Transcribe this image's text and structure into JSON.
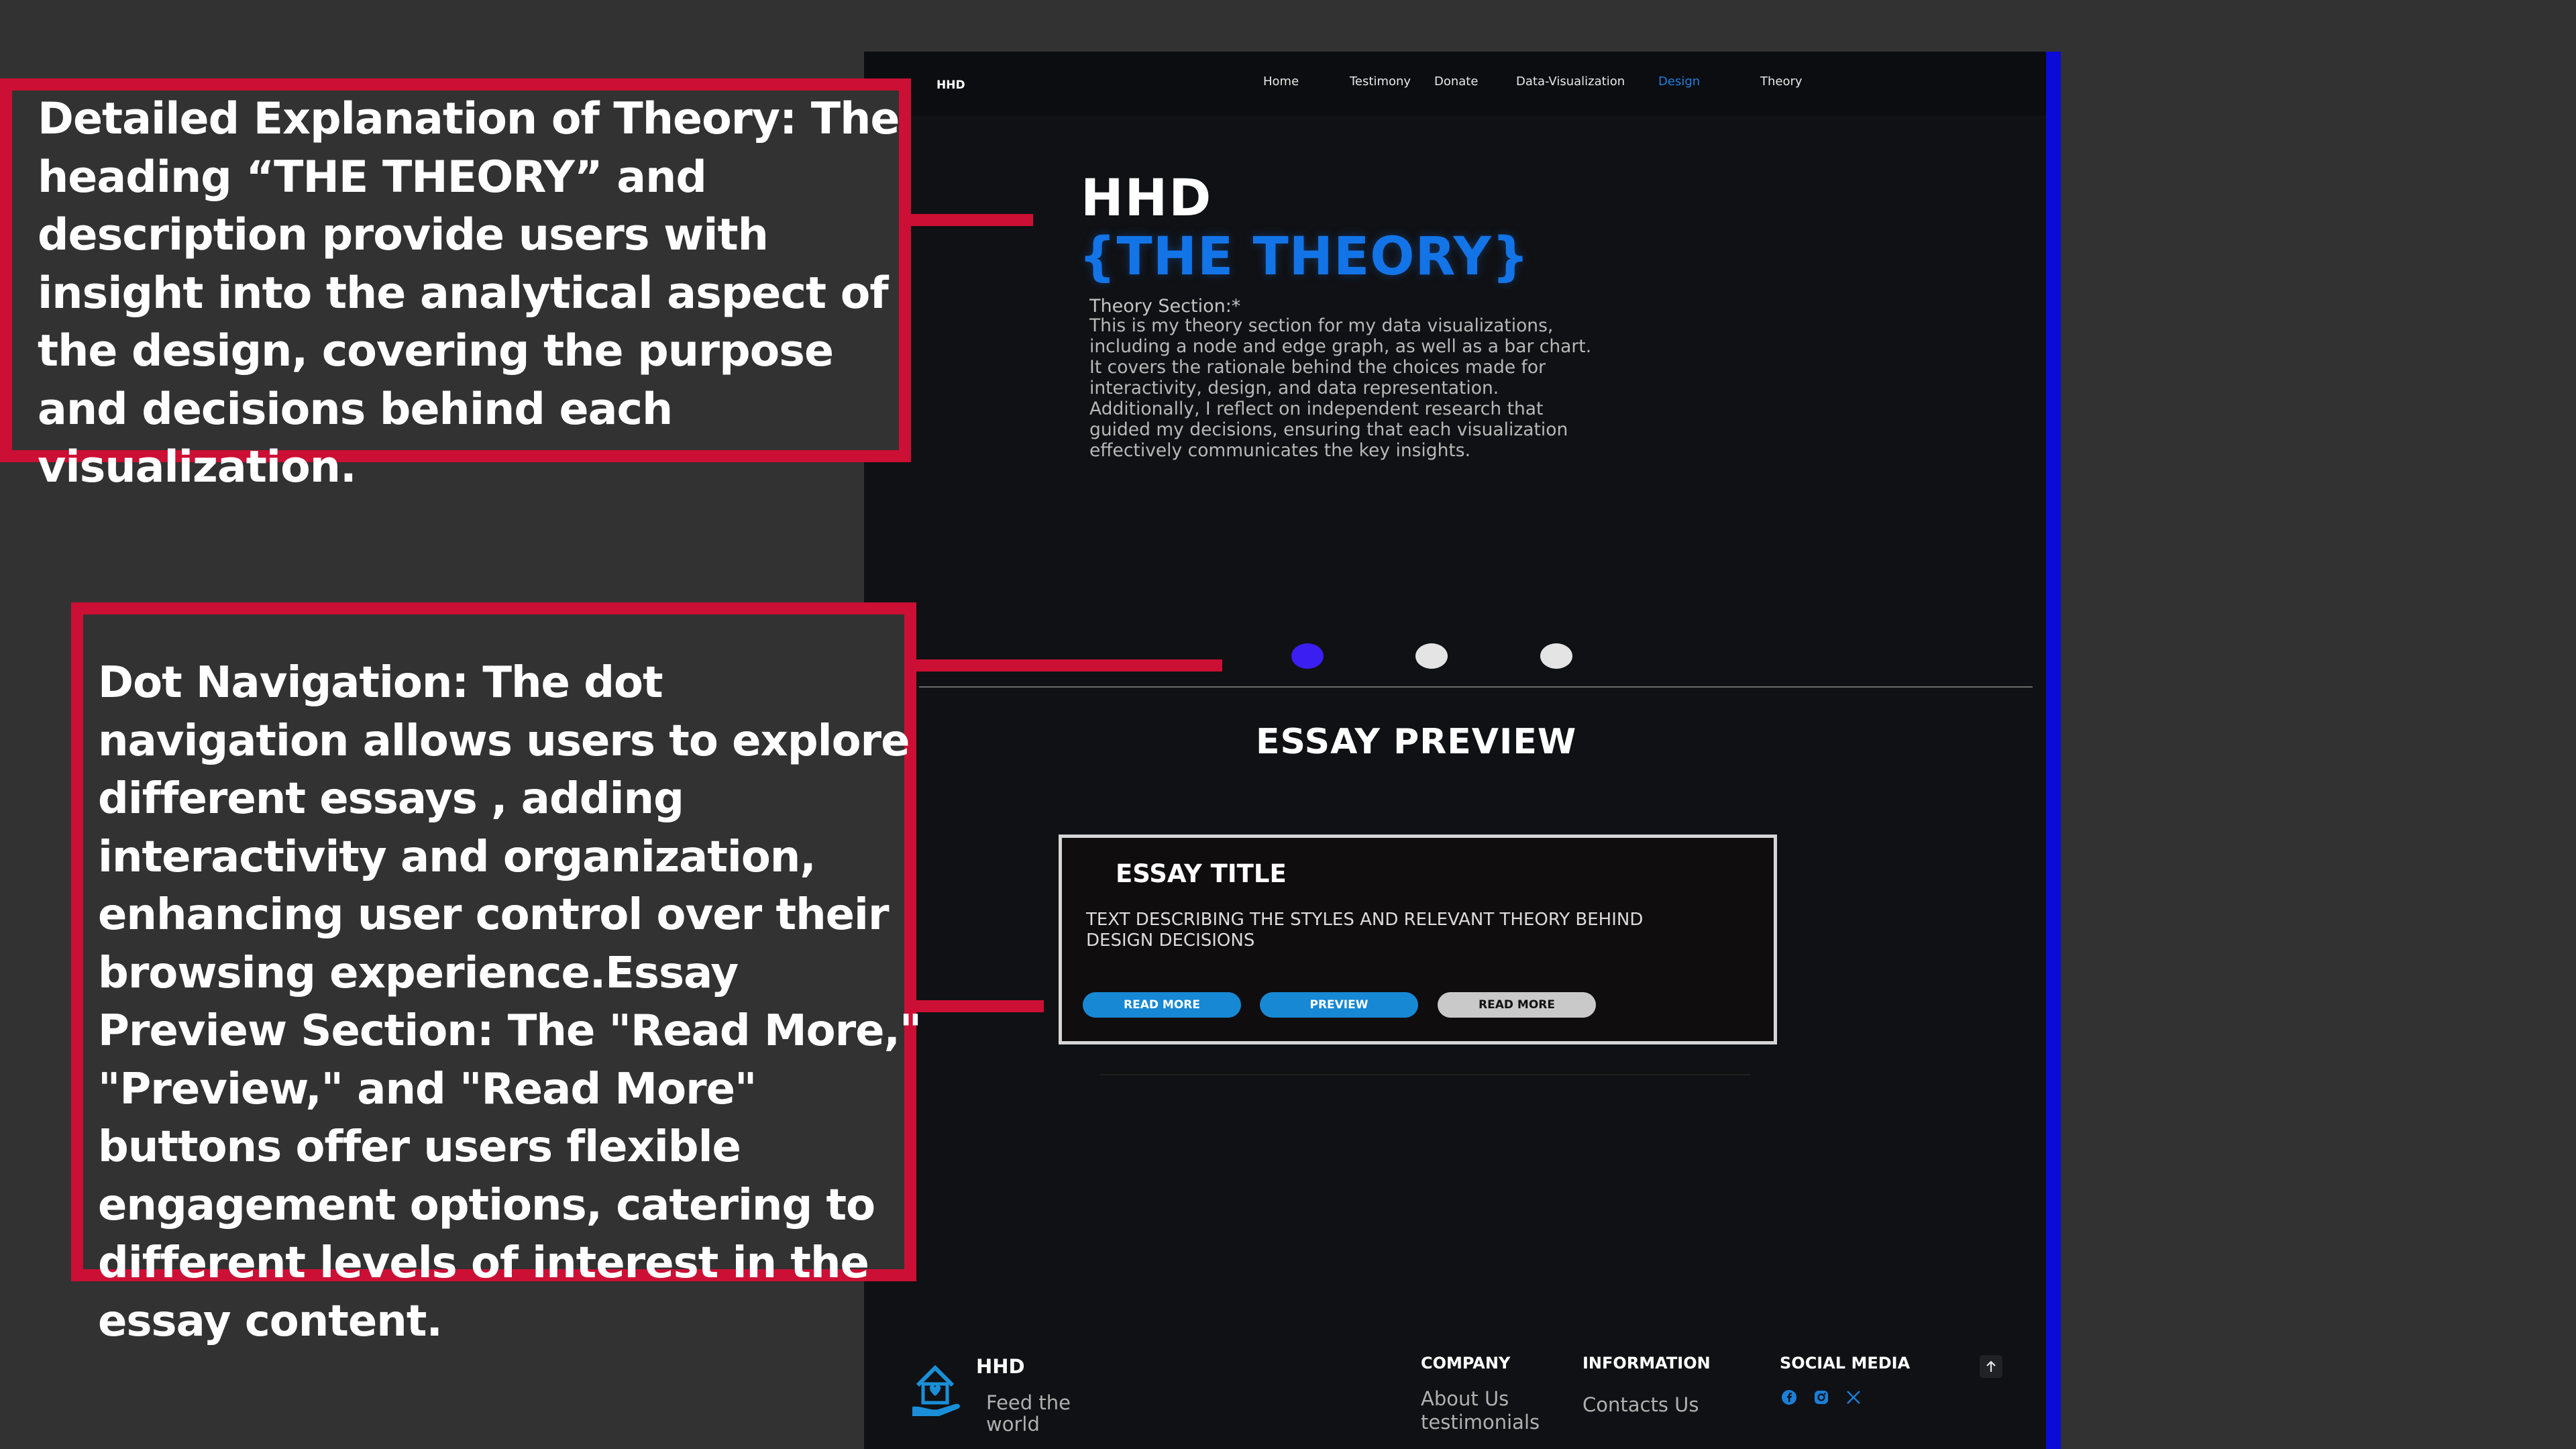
{
  "nav": {
    "logo": "HHD",
    "items": [
      {
        "label": "Home"
      },
      {
        "label": "Testimony"
      },
      {
        "label": "Donate"
      },
      {
        "label": "Data-Visualization"
      },
      {
        "label": "Design"
      },
      {
        "label": "Theory"
      }
    ]
  },
  "hero": {
    "title": "HHD",
    "subtitle": "{THE THEORY}",
    "section_label": "Theory Section:*",
    "description": "This is my theory section for my data visualizations, including a node and edge graph, as well as a bar chart. It covers the rationale behind the choices made for interactivity, design, and data representation. Additionally, I reflect on independent research that guided my decisions, ensuring that each visualization effectively communicates the key insights."
  },
  "dot_navigation": {
    "dots": [
      {
        "active": true,
        "color": "#3b1ff2"
      },
      {
        "active": false,
        "color": "#e4e4e4"
      },
      {
        "active": false,
        "color": "#e4e4e4"
      }
    ]
  },
  "essay_preview": {
    "heading": "ESSAY PREVIEW",
    "card": {
      "title": "ESSAY TITLE",
      "text": "TEXT DESCRIBING THE STYLES AND RELEVANT THEORY BEHIND DESIGN DECISIONS",
      "buttons": [
        {
          "label": "READ MORE"
        },
        {
          "label": "PREVIEW"
        },
        {
          "label": "READ MORE"
        }
      ]
    }
  },
  "footer": {
    "brand": "HHD",
    "tagline": "Feed the world",
    "company": {
      "heading": "COMPANY",
      "links": [
        "About Us",
        "testimonials"
      ]
    },
    "information": {
      "heading": "INFORMATION",
      "links": [
        "Contacts Us"
      ]
    },
    "social": {
      "heading": "SOCIAL MEDIA",
      "icons": [
        "facebook-icon",
        "instagram-icon",
        "x-icon"
      ]
    }
  },
  "annotations": [
    {
      "text": "Detailed Explanation of Theory: The heading “THE THEORY” and description provide users with insight into the analytical aspect of the design, covering the purpose and decisions behind each visualization."
    },
    {
      "text": "Dot Navigation: The dot navigation allows users to explore different essays , adding interactivity and organization, enhancing user control over their browsing experience.Essay Preview Section: The \"Read More,\" \"Preview,\" and \"Read More\" buttons offer users flexible engagement options, catering to different levels of interest in the essay content."
    }
  ],
  "colors": {
    "background": "#323232",
    "site_bg": "#101114",
    "accent_blue": "#1374e8",
    "button_blue": "#1788d4",
    "annotation_red": "#cc0f34",
    "scrollbar": "#0a0bd9"
  }
}
